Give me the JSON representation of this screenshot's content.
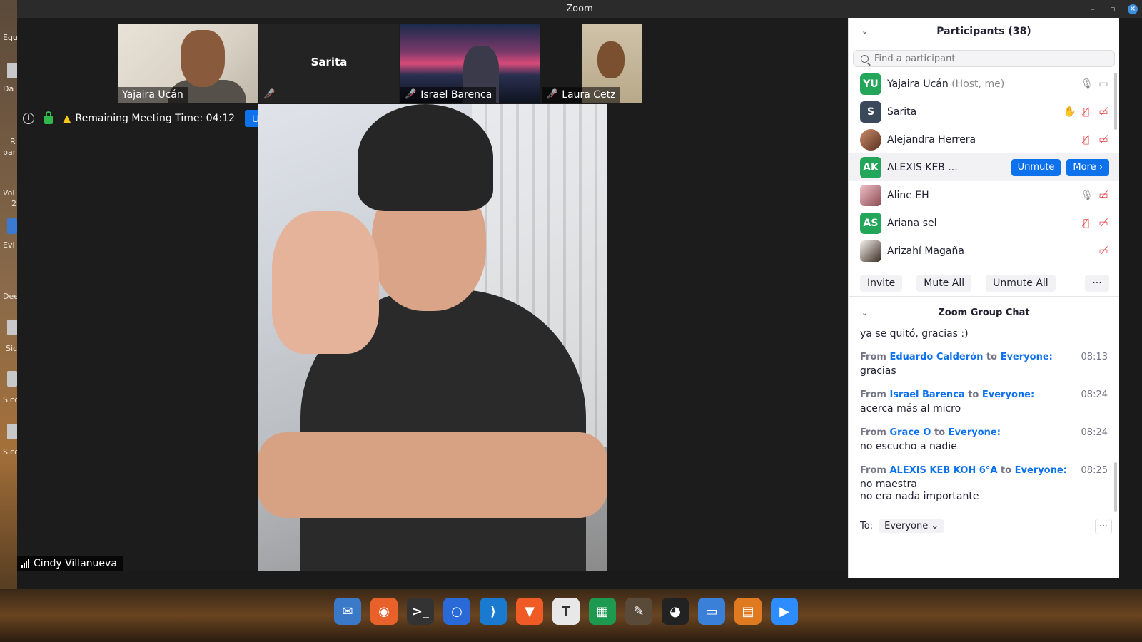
{
  "window": {
    "title": "Zoom"
  },
  "desktop": {
    "labels": [
      "Equ",
      "Da",
      "R",
      "par",
      "Vol",
      "2",
      "Evi",
      "Dee",
      "Sic",
      "Sicc",
      "Sicc"
    ]
  },
  "thumbnails": [
    {
      "name": "Yajaira Ucán",
      "muted": false
    },
    {
      "name": "Sarita",
      "label": "Sarita",
      "muted": true
    },
    {
      "name": "Israel Barenca",
      "muted": true
    },
    {
      "name": "Laura Cetz",
      "muted": true
    }
  ],
  "meeting": {
    "remaining_label": "Remaining Meeting Time: 04:12",
    "upgrade_label": "Upgrade",
    "active_speaker": "Cindy Villanueva"
  },
  "participants": {
    "header": "Participants (38)",
    "search_placeholder": "Find a participant",
    "items": [
      {
        "initials": "YU",
        "name": "Yajaira Ucán",
        "role": "(Host, me)",
        "avatar": "green",
        "mic": "on",
        "video": "on"
      },
      {
        "initials": "S",
        "name": "Sarita",
        "role": "",
        "avatar": "dark",
        "mic": "muted",
        "video": "off",
        "hand": true
      },
      {
        "initials": "",
        "name": "Alejandra Herrera",
        "role": "",
        "avatar": "photo1",
        "mic": "muted",
        "video": "off"
      },
      {
        "initials": "AK",
        "name": "ALEXIS KEB ...",
        "role": "",
        "avatar": "green",
        "unmute_label": "Unmute",
        "more_label": "More"
      },
      {
        "initials": "",
        "name": "Aline EH",
        "role": "",
        "avatar": "photo2",
        "mic": "on",
        "video": "off"
      },
      {
        "initials": "AS",
        "name": "Ariana sel",
        "role": "",
        "avatar": "green",
        "mic": "muted",
        "video": "off"
      },
      {
        "initials": "",
        "name": "Arizahí Magaña",
        "role": "",
        "avatar": "photo3",
        "video": "off"
      }
    ],
    "actions": {
      "invite": "Invite",
      "mute_all": "Mute All",
      "unmute_all": "Unmute All",
      "more": "···"
    }
  },
  "chat": {
    "header": "Zoom Group Chat",
    "first_message": "ya se quitó, gracias :)",
    "from_word": "From",
    "to_word": "to",
    "messages": [
      {
        "from": "Eduardo Calderón",
        "to": "Everyone:",
        "time": "08:13",
        "lines": [
          "gracias"
        ]
      },
      {
        "from": "Israel Barenca",
        "to": "Everyone:",
        "time": "08:24",
        "lines": [
          "acerca más al micro"
        ]
      },
      {
        "from": "Grace O",
        "to": "Everyone:",
        "time": "08:24",
        "lines": [
          "no escucho a nadie"
        ]
      },
      {
        "from": "ALEXIS KEB KOH 6°A",
        "to": "Everyone:",
        "time": "08:25",
        "lines": [
          "no maestra",
          "no era nada importante"
        ]
      }
    ],
    "to_label": "To:",
    "to_value": "Everyone",
    "more": "···"
  },
  "dock": {
    "apps": [
      {
        "name": "thunderbird",
        "color": "#3a78c8",
        "glyph": "✉"
      },
      {
        "name": "firefox",
        "color": "#e8602a",
        "glyph": "◉"
      },
      {
        "name": "terminal",
        "color": "#333333",
        "glyph": ">_"
      },
      {
        "name": "chromium",
        "color": "#2a6ad8",
        "glyph": "○"
      },
      {
        "name": "vscode",
        "color": "#1a7ad0",
        "glyph": "⟩"
      },
      {
        "name": "brave",
        "color": "#f05a24",
        "glyph": "▼"
      },
      {
        "name": "typora",
        "color": "#e8e8e8",
        "glyph": "T"
      },
      {
        "name": "sheets",
        "color": "#1e9a50",
        "glyph": "▦"
      },
      {
        "name": "gimp",
        "color": "#5a4a3a",
        "glyph": "✎"
      },
      {
        "name": "inkscape",
        "color": "#222222",
        "glyph": "◕"
      },
      {
        "name": "files",
        "color": "#3a80d8",
        "glyph": "▭"
      },
      {
        "name": "impress",
        "color": "#e07a20",
        "glyph": "▤"
      },
      {
        "name": "zoom",
        "color": "#2d8cff",
        "glyph": "▶"
      }
    ]
  }
}
